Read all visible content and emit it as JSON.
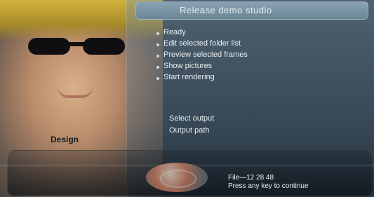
{
  "window": {
    "title": "Release demo studio"
  },
  "panel": {
    "items": [
      "Ready",
      "Edit selected folder list",
      "Preview selected frames",
      "Show pictures",
      "Start rendering"
    ],
    "items2": [
      "Select output",
      "Output path"
    ]
  },
  "footer": {
    "label": "Design",
    "status_line1": "File—12 28 48",
    "status_line2": "Press any key to continue"
  }
}
